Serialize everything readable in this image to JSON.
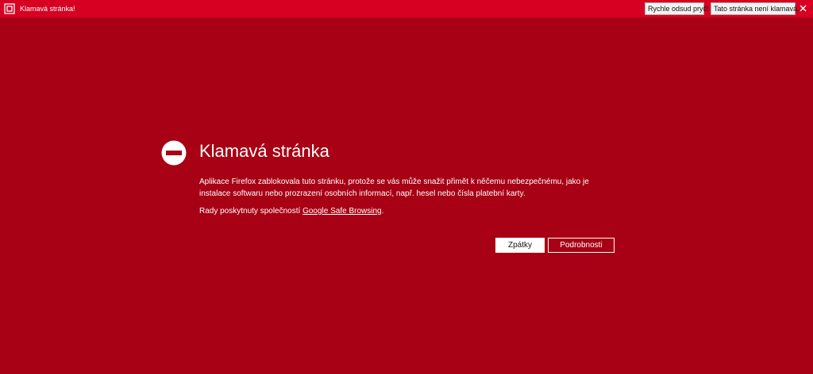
{
  "notification_bar": {
    "message": "Klamavá stránka!",
    "get_away_label": "Rychle odsud pryč!",
    "not_deceptive_label": "Tato stránka není klamavá...",
    "icon": "warning-shield-icon",
    "close_icon": "close-icon"
  },
  "error_page": {
    "icon": "blocked-icon",
    "title": "Klamavá stránka",
    "description": "Aplikace Firefox zablokovala tuto stránku, protože se vás může snažit přimět k něčemu nebezpečnému, jako je instalace softwaru nebo prozrazení osobních informací, např. hesel nebo čísla platební karty.",
    "advisory_prefix": "Rady poskytnuty společností ",
    "advisory_link": "Google Safe Browsing",
    "advisory_suffix": ".",
    "back_button": "Zpátky",
    "details_button": "Podrobnosti"
  },
  "colors": {
    "page_background": "#a80014",
    "notification_background": "#d70022",
    "text": "#ffffff"
  }
}
